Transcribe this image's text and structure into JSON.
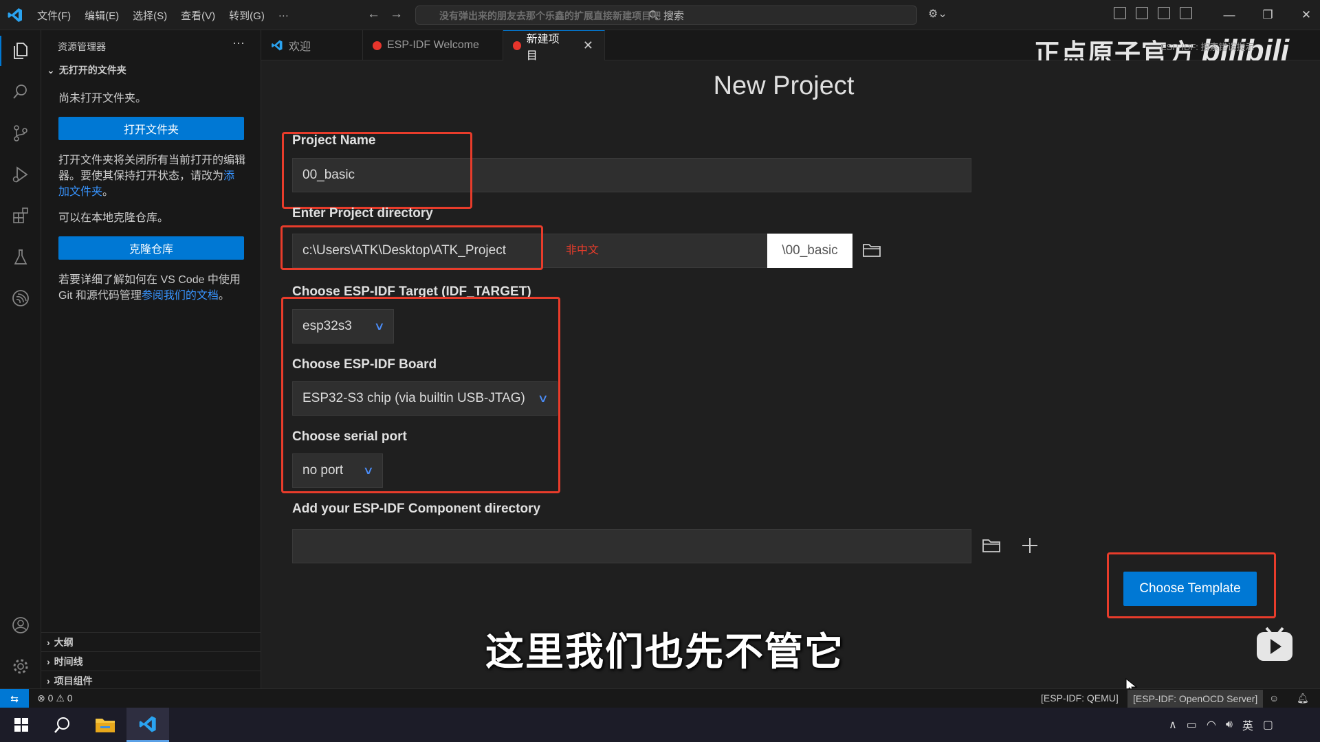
{
  "titlebar": {
    "menu": [
      "文件(F)",
      "编辑(E)",
      "选择(S)",
      "查看(V)",
      "转到(G)",
      "···"
    ],
    "search_placeholder": "搜索",
    "overlay_text": "没有弹出来的朋友去那个乐鑫的扩展直接新建项目吧"
  },
  "sidebar": {
    "title": "资源管理器",
    "more": "···",
    "section": "无打开的文件夹",
    "no_folder_text": "尚未打开文件夹。",
    "open_folder_btn": "打开文件夹",
    "open_folder_desc": "打开文件夹将关闭所有当前打开的编辑器。要使其保持打开状态，请改为",
    "add_folder_link": "添加文件夹",
    "period": "。",
    "clone_text": "可以在本地克隆仓库。",
    "clone_btn": "克隆仓库",
    "learn_more_text": "若要详细了解如何在 VS Code 中使用 Git 和源代码管理",
    "docs_link": "参阅我们的文档",
    "bottom_sections": [
      "大纲",
      "时间线",
      "项目组件"
    ]
  },
  "tabs": [
    {
      "label": "欢迎",
      "icon": "vscode-icon"
    },
    {
      "label": "ESP-IDF Welcome",
      "icon": "esp-idf-icon"
    },
    {
      "label": "新建项目",
      "icon": "esp-idf-icon",
      "close": "✕"
    }
  ],
  "watermark": {
    "brand": "正点原子官方",
    "site": "bilibili",
    "faint": "ESP-IDF: 搜索错误提示"
  },
  "form": {
    "title": "New Project",
    "project_name_label": "Project Name",
    "project_name_value": "00_basic",
    "directory_label": "Enter Project directory",
    "directory_value": "c:\\Users\\ATK\\Desktop\\ATK_Project",
    "directory_suffix": "\\00_basic",
    "non_chinese_note": "非中文",
    "target_label": "Choose ESP-IDF Target (IDF_TARGET)",
    "target_value": "esp32s3",
    "board_label": "Choose ESP-IDF Board",
    "board_value": "ESP32-S3 chip (via builtin USB-JTAG)",
    "port_label": "Choose serial port",
    "port_value": "no port",
    "component_label": "Add your ESP-IDF Component directory",
    "component_value": "",
    "choose_template_btn": "Choose Template"
  },
  "subtitle": "这里我们也先不管它",
  "statusbar": {
    "errors": "0",
    "warnings": "0",
    "qemu": "[ESP-IDF: QEMU]",
    "openocd": "[ESP-IDF: OpenOCD Server]"
  },
  "taskbar": {
    "ime": "英"
  },
  "colors": {
    "accent": "#0078d4",
    "highlight_box": "#e83c2b",
    "esp_red": "#e7352c"
  }
}
